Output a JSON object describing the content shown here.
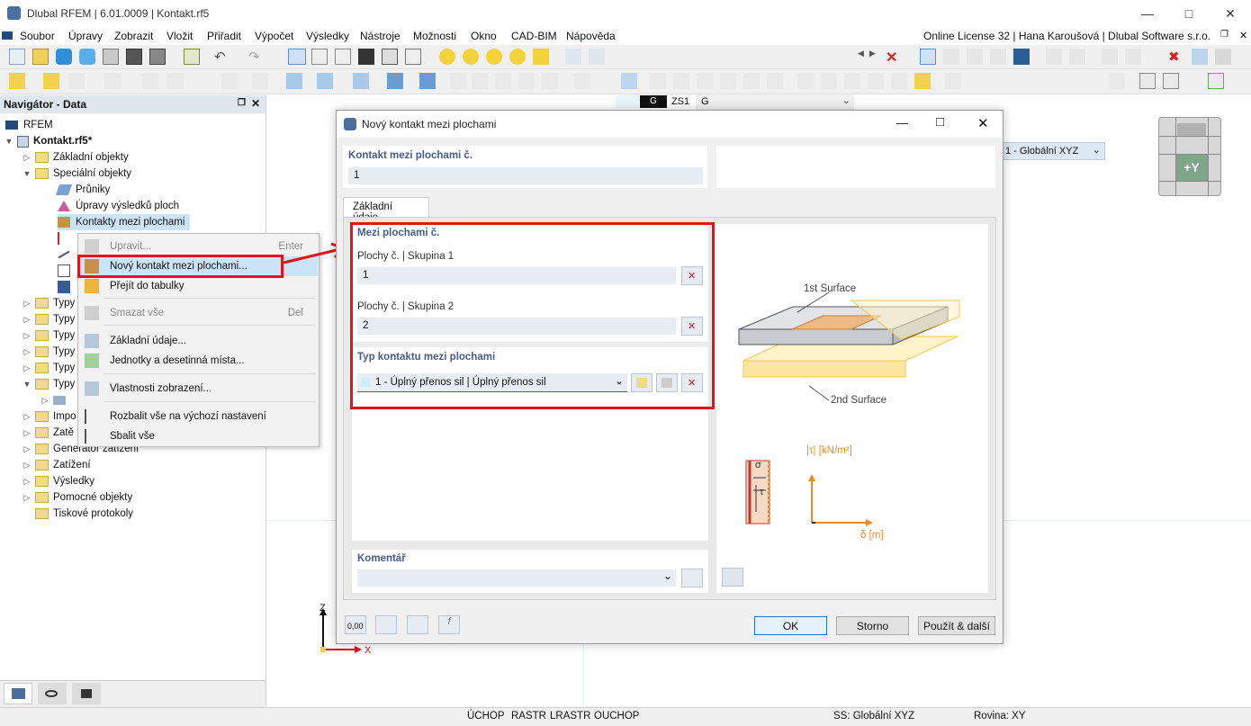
{
  "app": {
    "title": "Dlubal RFEM | 6.01.0009 | Kontakt.rf5",
    "license": "Online License 32 | Hana Karoušová | Dlubal Software s.r.o."
  },
  "menu": [
    "Soubor",
    "Úpravy",
    "Zobrazit",
    "Vložit",
    "Přiřadit",
    "Výpočet",
    "Výsledky",
    "Nástroje",
    "Možnosti",
    "Okno",
    "CAD-BIM",
    "Nápověda"
  ],
  "toolbar": {
    "loadcase_badge": "G",
    "loadcase_code": "ZS1",
    "loadcase_name": "G",
    "coord_system": "1 - Globální XYZ"
  },
  "navigator": {
    "title": "Navigátor - Data",
    "root": "RFEM",
    "file": "Kontakt.rf5*",
    "items": {
      "zakladni": "Základní objekty",
      "specialni": "Speciální objekty",
      "pruniky": "Průniky",
      "upravy": "Úpravy výsledků ploch",
      "kontakty": "Kontakty mezi plochami",
      "typy1": "Typy",
      "typy2": "Typy",
      "typy3": "Typy",
      "typy4": "Typy",
      "typy5": "Typy",
      "typy6": "Typy",
      "impo": "Impo",
      "zate": "Zatě",
      "generator": "Generátor zatížení",
      "zatizeni": "Zatížení",
      "vysledky": "Výsledky",
      "pomocne": "Pomocné objekty",
      "tiskove": "Tiskové protokoly"
    }
  },
  "context_menu": {
    "upravit": "Upravit...",
    "upravit_sc": "Enter",
    "novy": "Nový kontakt mezi plochami...",
    "prejit": "Přejít do tabulky",
    "smazat": "Smazat vše",
    "smazat_sc": "Del",
    "zakladni": "Základní údaje...",
    "jednotky": "Jednotky a desetinná místa...",
    "vlastnosti": "Vlastnosti zobrazení...",
    "rozbalit": "Rozbalit vše na výchozí nastavení",
    "sbalit": "Sbalit vše"
  },
  "dialog": {
    "title": "Nový kontakt mezi plochami",
    "number_label": "Kontakt mezi plochami č.",
    "number_value": "1",
    "tab": "Základní údaje",
    "between_header": "Mezi plochami č.",
    "group1_label": "Plochy č. | Skupina 1",
    "group1_value": "1",
    "group2_label": "Plochy č. | Skupina 2",
    "group2_value": "2",
    "type_header": "Typ kontaktu mezi plochami",
    "type_value": "1 - Úplný přenos sil | Úplný přenos sil",
    "comment_label": "Komentář",
    "ok": "OK",
    "cancel": "Storno",
    "apply_next": "Použít & další",
    "decimals": "0,00"
  },
  "illustration": {
    "surface1": "1st Surface",
    "surface2": "2nd Surface",
    "sigma": "σ",
    "tau": "τ",
    "yaxis": "|τ| [kN/m²]",
    "xaxis": "δ [m]"
  },
  "viewcube": {
    "label": "+Y"
  },
  "axes": {
    "z": "Z",
    "x": "X"
  },
  "statusbar": {
    "items": [
      "ÚCHOP",
      "RASTR",
      "LRASTR",
      "OUCHOP"
    ],
    "ss": "SS: Globální XYZ",
    "plane": "Rovina: XY"
  },
  "colors": {
    "highlight_red": "#e0151b",
    "accent_blue": "#4a5b8a",
    "orange": "#f08a24"
  }
}
